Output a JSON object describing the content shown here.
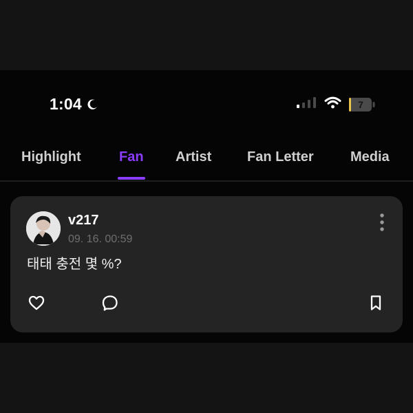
{
  "status_bar": {
    "time": "1:04",
    "moon_icon": "moon-icon",
    "signal_icon": "signal-bars-icon",
    "wifi_icon": "wifi-icon",
    "battery_level": "7"
  },
  "tabs": [
    {
      "label": "Highlight",
      "active": false
    },
    {
      "label": "Fan",
      "active": true
    },
    {
      "label": "Artist",
      "active": false
    },
    {
      "label": "Fan Letter",
      "active": false
    },
    {
      "label": "Media",
      "active": false
    }
  ],
  "post": {
    "username": "v217",
    "timestamp": "09. 16. 00:59",
    "text": "태태 충전 몇 %?",
    "actions": {
      "like_icon": "heart-icon",
      "comment_icon": "comment-icon",
      "bookmark_icon": "bookmark-icon",
      "more_icon": "more-vertical-icon"
    }
  },
  "colors": {
    "accent": "#8b3dff",
    "background": "#050505",
    "card": "#242424",
    "text": "#ffffff",
    "muted": "#6f6f6f",
    "battery": "#e7c44a"
  }
}
